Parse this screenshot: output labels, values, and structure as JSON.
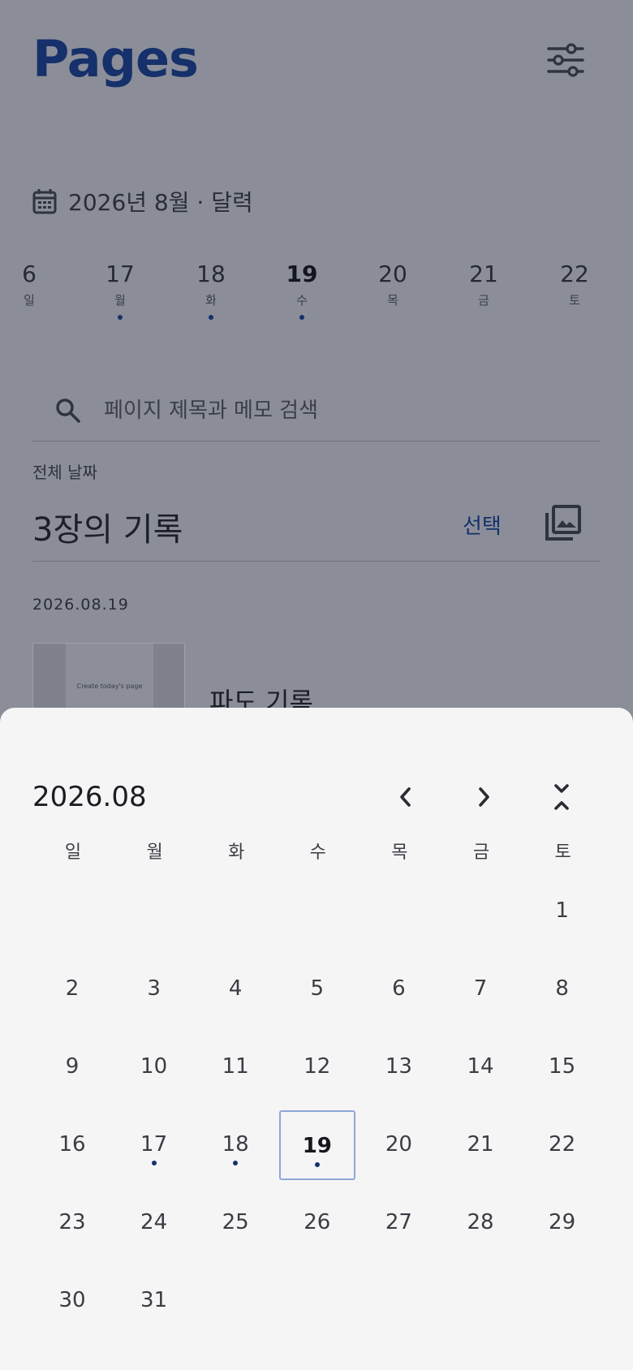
{
  "app": {
    "title": "Pages"
  },
  "header": {
    "month_label": "2026년 8월 · 달력"
  },
  "week_strip": [
    {
      "num": "6",
      "label": "일",
      "dot": false,
      "selected": false
    },
    {
      "num": "17",
      "label": "월",
      "dot": true,
      "selected": false
    },
    {
      "num": "18",
      "label": "화",
      "dot": true,
      "selected": false
    },
    {
      "num": "19",
      "label": "수",
      "dot": true,
      "selected": true
    },
    {
      "num": "20",
      "label": "목",
      "dot": false,
      "selected": false
    },
    {
      "num": "21",
      "label": "금",
      "dot": false,
      "selected": false
    },
    {
      "num": "22",
      "label": "토",
      "dot": false,
      "selected": false
    }
  ],
  "search": {
    "placeholder": "페이지 제목과 메모 검색"
  },
  "list": {
    "range_label": "전체 날짜",
    "count_title": "3장의 기록",
    "select_label": "선택",
    "date_group": "2026.08.19",
    "thumb_caption": "Create today's page",
    "entry_title": "파도 기록"
  },
  "calendar": {
    "title": "2026.08",
    "weekdays": [
      "일",
      "월",
      "화",
      "수",
      "목",
      "금",
      "토"
    ],
    "first_weekday_index": 6,
    "days_in_month": 31,
    "selected_day": 19,
    "dot_days": [
      17,
      18,
      19
    ]
  },
  "colors": {
    "accent": "#15306a",
    "overlay": "#8b8e99",
    "sheet": "#f5f5f6"
  }
}
